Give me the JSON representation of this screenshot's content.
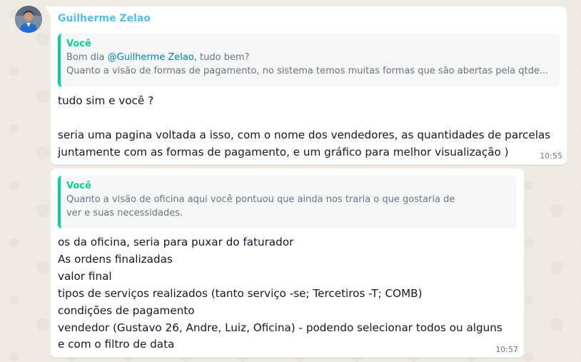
{
  "chat": {
    "sender_name": "Guilherme Zelao",
    "avatar_icon": "user-photo-avatar",
    "message1": {
      "quote_author": "Você",
      "quote_prefix": "Bom dia ",
      "quote_mention": "@Guilherme Zelao",
      "quote_suffix": ", tudo bem?",
      "quote_line2": "Quanto a visão de formas de pagamento, no sistema temos muitas formas que são abertas pela qtde...",
      "lines": [
        "tudo sim e você ?",
        "",
        "seria uma pagina voltada a isso, com o nome dos vendedores, as quantidades de parcelas",
        "juntamente com as formas de pagamento, e um gráfico para melhor visualização )"
      ],
      "time": "10:55"
    },
    "message2": {
      "quote_author": "Você",
      "quote_line1": "Quanto a visão de oficina aqui você pontuou que ainda nos traria o que gostaria de",
      "quote_line2": "ver e suas necessidades.",
      "lines": [
        "os da oficina, seria para puxar do faturador",
        "As ordens finalizadas",
        "valor final",
        "tipos de serviços realizados (tanto serviço -se; Tercetiros -T; COMB)",
        "condições de pagamento",
        "vendedor (Gustavo 26, Andre, Luiz, Oficina) - podendo selecionar todos ou alguns",
        "e com o filtro de data"
      ],
      "time": "10:57"
    }
  },
  "colors": {
    "background": "#efeae2",
    "bubble": "#ffffff",
    "sender_name": "#53bdeb",
    "quote_accent": "#06cf9c",
    "mention": "#027eb5"
  }
}
